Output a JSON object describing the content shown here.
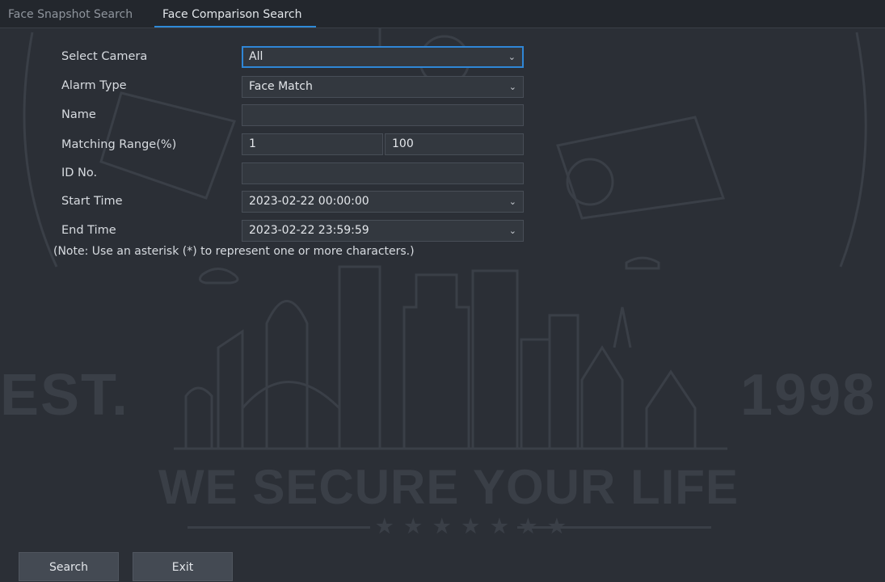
{
  "tabs": [
    {
      "label": "Face Snapshot Search",
      "active": false
    },
    {
      "label": "Face Comparison Search",
      "active": true
    }
  ],
  "form": {
    "select_camera": {
      "label": "Select Camera",
      "value": "All"
    },
    "alarm_type": {
      "label": "Alarm Type",
      "value": "Face Match"
    },
    "name": {
      "label": "Name",
      "value": ""
    },
    "matching_range": {
      "label": "Matching Range(%)",
      "min": "1",
      "max": "100"
    },
    "id_no": {
      "label": "ID No.",
      "value": ""
    },
    "start_time": {
      "label": "Start Time",
      "value": "2023-02-22 00:00:00"
    },
    "end_time": {
      "label": "End Time",
      "value": "2023-02-22 23:59:59"
    },
    "note": "(Note: Use an asterisk (*) to represent one or more characters.)"
  },
  "buttons": {
    "search": "Search",
    "exit": "Exit"
  },
  "watermark": {
    "est": "EST.",
    "year": "1998",
    "slogan": "WE SECURE YOUR LIFE",
    "stars": "★★★★★★★"
  },
  "icons": {
    "dropdown": "chevron-down-icon"
  },
  "colors": {
    "accent": "#2f86d6",
    "background": "#2b2f36"
  }
}
